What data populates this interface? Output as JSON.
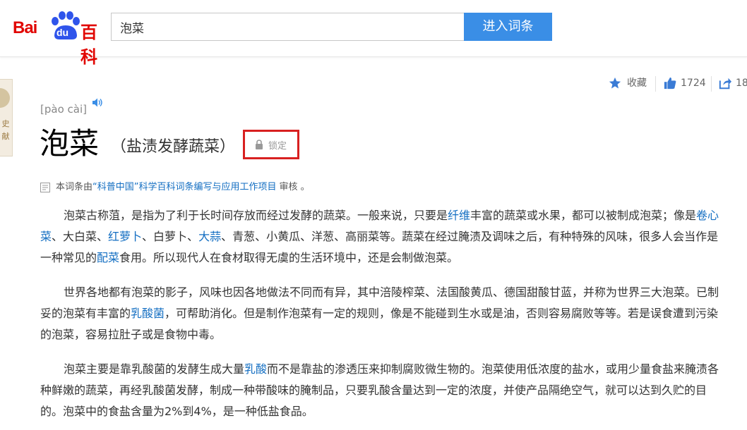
{
  "header": {
    "logo_bai": "Bai",
    "logo_du": "du",
    "logo_baike": "百科",
    "search_value": "泡菜",
    "search_button": "进入词条"
  },
  "side_tab": {
    "text": "史 献"
  },
  "tools": {
    "favorite_label": "收藏",
    "like_count": "1724",
    "share_count": "18"
  },
  "entry": {
    "pinyin": "[pào cài]",
    "title": "泡菜",
    "subtitle": "（盐渍发酵蔬菜）",
    "lock_label": "锁定"
  },
  "review": {
    "prefix": "本词条由",
    "org": "“科普中国”科学百科词条编写与应用工作项目",
    "suffix": "审核 。"
  },
  "paragraphs": [
    {
      "segments": [
        {
          "text": "泡菜古称菹，是指为了利于长时间存放而经过发酵的蔬菜。一般来说，只要是"
        },
        {
          "text": "纤维",
          "link": true
        },
        {
          "text": "丰富的蔬菜或水果，都可以被制成泡菜；像是"
        },
        {
          "text": "卷心菜",
          "link": true
        },
        {
          "text": "、大白菜、"
        },
        {
          "text": "红萝卜",
          "link": true
        },
        {
          "text": "、白萝卜、"
        },
        {
          "text": "大蒜",
          "link": true
        },
        {
          "text": "、青葱、小黄瓜、洋葱、高丽菜等。蔬菜在经过腌渍及调味之后，有种特殊的风味，很多人会当作是一种常见的"
        },
        {
          "text": "配菜",
          "link": true
        },
        {
          "text": "食用。所以现代人在食材取得无虞的生活环境中，还是会制做泡菜。"
        }
      ]
    },
    {
      "segments": [
        {
          "text": "世界各地都有泡菜的影子，风味也因各地做法不同而有异，其中涪陵榨菜、法国酸黄瓜、德国甜酸甘蓝，并称为世界三大泡菜。已制妥的泡菜有丰富的"
        },
        {
          "text": "乳酸菌",
          "link": true
        },
        {
          "text": "，可帮助消化。但是制作泡菜有一定的规则，像是不能碰到生水或是油，否则容易腐败等等。若是误食遭到污染的泡菜，容易拉肚子或是食物中毒。"
        }
      ]
    },
    {
      "segments": [
        {
          "text": "泡菜主要是靠乳酸菌的发酵生成大量"
        },
        {
          "text": "乳酸",
          "link": true
        },
        {
          "text": "而不是靠盐的渗透压来抑制腐败微生物的。泡菜使用低浓度的盐水，或用少量食盐来腌渍各种鲜嫩的蔬菜，再经乳酸菌发酵，制成一种带酸味的腌制品，只要乳酸含量达到一定的浓度，并使产品隔绝空气，就可以达到久贮的目的。泡菜中的食盐含量为2%到4%，是一种低盐食品。"
        }
      ]
    }
  ],
  "colors": {
    "brand_red": "#e10602",
    "link_blue": "#136ec2",
    "button_blue": "#3a8ee6",
    "lock_border": "#d82020"
  }
}
